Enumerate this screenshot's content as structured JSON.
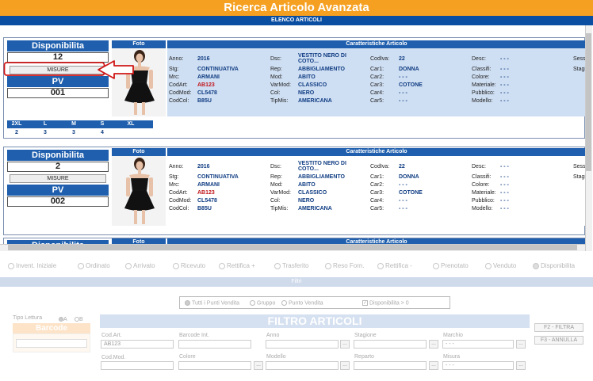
{
  "header": {
    "title": "Ricerca Articolo Avanzata",
    "subtitle": "ELENCO ARTICOLI"
  },
  "labels": {
    "disponibilita": "Disponibilita",
    "misure": "MISURE",
    "pv": "PV",
    "foto": "Foto",
    "caratteristiche": "Caratteristiche Articolo"
  },
  "fields": {
    "anno": "Anno:",
    "stg": "Stg:",
    "mrc": "Mrc:",
    "codart": "CodArt:",
    "codmod": "CodMod:",
    "codcol": "CodCol:",
    "dsc": "Dsc:",
    "rep": "Rep:",
    "mod": "Mod:",
    "varmod": "VarMod:",
    "col": "Col:",
    "tipmis": "TipMis:",
    "codiva": "CodIva:",
    "car1": "Car1:",
    "car2": "Car2:",
    "car3": "Car3:",
    "car4": "Car4:",
    "car5": "Car5:",
    "desc": "Desc:",
    "classifi": "Classifi:",
    "colore": "Colore:",
    "materiale": "Materiale:",
    "pubblico": "Pubblico:",
    "modello": "Modello:",
    "sesso": "Sesso",
    "stagi": "Stagi"
  },
  "items": [
    {
      "disponibilita": "12",
      "pv": "001",
      "anno": "2016",
      "stg": "CONTINUATIVA",
      "mrc": "ARMANI",
      "codart": "AB123",
      "codmod": "CL5478",
      "codcol": "B85U",
      "dsc": "VESTITO NERO DI COTO...",
      "rep": "ABBIGLIAMENTO",
      "mod": "ABITO",
      "varmod": "CLASSICO",
      "col": "NERO",
      "tipmis": "AMERICANA",
      "codiva": "22",
      "car1": "DONNA",
      "car2": "- - -",
      "car3": "COTONE",
      "car4": "- - -",
      "car5": "- - -",
      "desc": "- - -",
      "classifi": "- - -",
      "colore": "- - -",
      "materiale": "- - -",
      "pubblico": "- - -",
      "modello": "- - -",
      "sizes": [
        {
          "label": "2XL",
          "qty": "2"
        },
        {
          "label": "L",
          "qty": "3"
        },
        {
          "label": "M",
          "qty": "3"
        },
        {
          "label": "S",
          "qty": "4"
        },
        {
          "label": "XL",
          "qty": ""
        }
      ]
    },
    {
      "disponibilita": "2",
      "pv": "002",
      "anno": "2016",
      "stg": "CONTINUATIVA",
      "mrc": "ARMANI",
      "codart": "AB123",
      "codmod": "CL5478",
      "codcol": "B85U",
      "dsc": "VESTITO NERO DI COTO...",
      "rep": "ABBIGLIAMENTO",
      "mod": "ABITO",
      "varmod": "CLASSICO",
      "col": "NERO",
      "tipmis": "AMERICANA",
      "codiva": "22",
      "car1": "DONNA",
      "car2": "- - -",
      "car3": "COTONE",
      "car4": "- - -",
      "car5": "- - -",
      "desc": "- - -",
      "classifi": "- - -",
      "colore": "- - -",
      "materiale": "- - -",
      "pubblico": "- - -",
      "modello": "- - -"
    }
  ],
  "tabs": [
    "Invent. Iniziale",
    "Ordinato",
    "Arrivato",
    "Ricevuto",
    "Rettifica +",
    "Trasferito",
    "Reso Forn.",
    "Rettifica -",
    "Prenotato",
    "Venduto",
    "Disponibilita"
  ],
  "filtri": {
    "bar": "Filtri",
    "opt_tutti": "Tutti i Punti Vendita",
    "opt_gruppo": "Gruppo",
    "opt_pv": "Punto Vendita",
    "chk_disp": "Disponibilita > 0",
    "tipo_lettura": "Tipo Lettura",
    "tl_a": "A",
    "tl_b": "B",
    "barcode": "Barcode",
    "title": "FILTRO ARTICOLI",
    "cod_art": "Cod.Art.",
    "cod_art_val": "AB123",
    "barcode_int": "Barcode Int.",
    "anno": "Anno",
    "stagione": "Stagione",
    "marchio": "Marchio",
    "marchio_val": "- - -",
    "cod_mod": "Cod.Mod.",
    "colore": "Colore",
    "modello": "Modello",
    "reparto": "Reparto",
    "misura": "Misura",
    "misura_val": "- - -",
    "btn_filtra": "F2 - FILTRA",
    "btn_annulla": "F3 - ANNULLA",
    "dots": "..."
  },
  "colors": {
    "header_bg": "#f5a020",
    "subbar_bg": "#0a4ea2",
    "label_bg": "#1f5fae",
    "card_bg": "#cfdff3",
    "highlight_red": "#c0161b"
  }
}
